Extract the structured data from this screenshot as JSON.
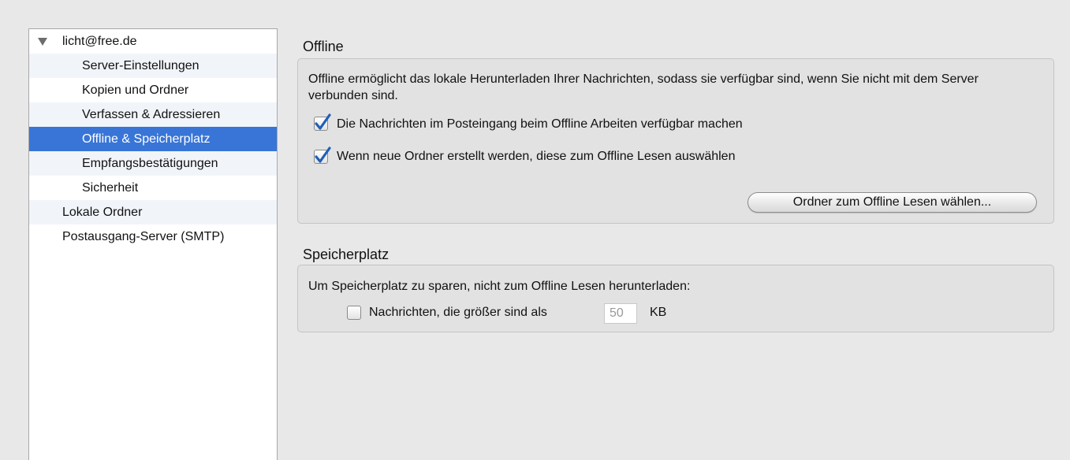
{
  "sidebar": {
    "items": [
      {
        "label": "licht@free.de"
      },
      {
        "label": "Server-Einstellungen"
      },
      {
        "label": "Kopien und Ordner"
      },
      {
        "label": "Verfassen & Adressieren"
      },
      {
        "label": "Offline & Speicherplatz"
      },
      {
        "label": "Empfangsbestätigungen"
      },
      {
        "label": "Sicherheit"
      },
      {
        "label": "Lokale Ordner"
      },
      {
        "label": "Postausgang-Server (SMTP)"
      }
    ],
    "selected": "Offline & Speicherplatz"
  },
  "offline": {
    "title": "Offline",
    "description": "Offline ermöglicht das lokale Herunterladen Ihrer Nachrichten, sodass sie verfügbar sind, wenn Sie nicht mit dem Server verbunden sind.",
    "inbox_offline_label": "Die Nachrichten im Posteingang beim Offline Arbeiten verfügbar machen",
    "inbox_offline_checked": true,
    "new_folders_label": "Wenn neue Ordner erstellt werden, diese zum Offline Lesen auswählen",
    "new_folders_checked": true,
    "select_folders_button": "Ordner zum Offline Lesen wählen..."
  },
  "storage": {
    "title": "Speicherplatz",
    "description": "Um Speicherplatz zu sparen, nicht zum Offline Lesen herunterladen:",
    "size_limit_label": "Nachrichten, die größer sind als",
    "size_limit_checked": false,
    "size_limit_value": "50",
    "size_unit": "KB"
  },
  "colors": {
    "selection": "#3875d7",
    "checkmark": "#1f5fb8",
    "window_bg": "#e8e8e8"
  }
}
